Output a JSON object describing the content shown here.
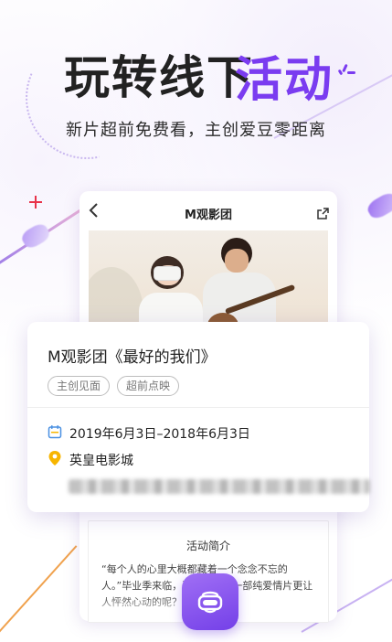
{
  "headline": {
    "part1": "玩转线下",
    "part2": "活动",
    "subtitle": "新片超前免费看，主创爱豆零距离"
  },
  "colors": {
    "accent": "#7a3cf0",
    "headline_text": "#222222",
    "location_pin": "#f7b500",
    "calendar_icon": "#4a90e2"
  },
  "phone": {
    "nav": {
      "back_icon": "chevron-left-icon",
      "title": "M观影团",
      "share_icon": "share-icon"
    },
    "intro": {
      "title": "活动简介",
      "text": "“每个人的心里大概都藏着一个念念不忘的人。”毕业季来临，还有什么比一部纯爱情片更让人怦然心动的呢？"
    }
  },
  "event_card": {
    "title": "M观影团《最好的我们》",
    "tags": [
      "主创见面",
      "超前点映"
    ],
    "date": "2019年6月3日–2018年6月3日",
    "location": "英皇电影城"
  },
  "fab": {
    "icon": "vr-headset-icon"
  }
}
